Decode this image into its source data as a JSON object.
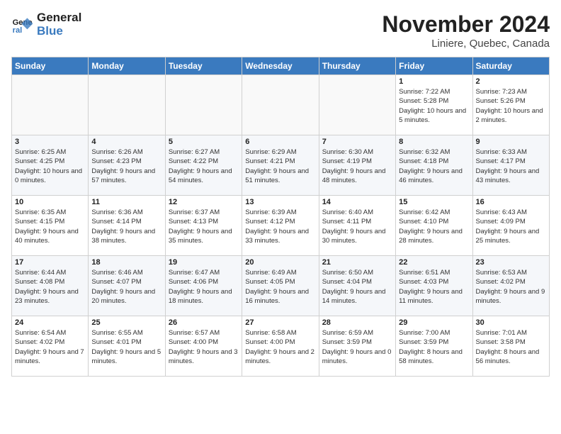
{
  "header": {
    "logo_line1": "General",
    "logo_line2": "Blue",
    "month_title": "November 2024",
    "location": "Liniere, Quebec, Canada"
  },
  "weekdays": [
    "Sunday",
    "Monday",
    "Tuesday",
    "Wednesday",
    "Thursday",
    "Friday",
    "Saturday"
  ],
  "weeks": [
    [
      {
        "day": "",
        "info": ""
      },
      {
        "day": "",
        "info": ""
      },
      {
        "day": "",
        "info": ""
      },
      {
        "day": "",
        "info": ""
      },
      {
        "day": "",
        "info": ""
      },
      {
        "day": "1",
        "info": "Sunrise: 7:22 AM\nSunset: 5:28 PM\nDaylight: 10 hours and 5 minutes."
      },
      {
        "day": "2",
        "info": "Sunrise: 7:23 AM\nSunset: 5:26 PM\nDaylight: 10 hours and 2 minutes."
      }
    ],
    [
      {
        "day": "3",
        "info": "Sunrise: 6:25 AM\nSunset: 4:25 PM\nDaylight: 10 hours and 0 minutes."
      },
      {
        "day": "4",
        "info": "Sunrise: 6:26 AM\nSunset: 4:23 PM\nDaylight: 9 hours and 57 minutes."
      },
      {
        "day": "5",
        "info": "Sunrise: 6:27 AM\nSunset: 4:22 PM\nDaylight: 9 hours and 54 minutes."
      },
      {
        "day": "6",
        "info": "Sunrise: 6:29 AM\nSunset: 4:21 PM\nDaylight: 9 hours and 51 minutes."
      },
      {
        "day": "7",
        "info": "Sunrise: 6:30 AM\nSunset: 4:19 PM\nDaylight: 9 hours and 48 minutes."
      },
      {
        "day": "8",
        "info": "Sunrise: 6:32 AM\nSunset: 4:18 PM\nDaylight: 9 hours and 46 minutes."
      },
      {
        "day": "9",
        "info": "Sunrise: 6:33 AM\nSunset: 4:17 PM\nDaylight: 9 hours and 43 minutes."
      }
    ],
    [
      {
        "day": "10",
        "info": "Sunrise: 6:35 AM\nSunset: 4:15 PM\nDaylight: 9 hours and 40 minutes."
      },
      {
        "day": "11",
        "info": "Sunrise: 6:36 AM\nSunset: 4:14 PM\nDaylight: 9 hours and 38 minutes."
      },
      {
        "day": "12",
        "info": "Sunrise: 6:37 AM\nSunset: 4:13 PM\nDaylight: 9 hours and 35 minutes."
      },
      {
        "day": "13",
        "info": "Sunrise: 6:39 AM\nSunset: 4:12 PM\nDaylight: 9 hours and 33 minutes."
      },
      {
        "day": "14",
        "info": "Sunrise: 6:40 AM\nSunset: 4:11 PM\nDaylight: 9 hours and 30 minutes."
      },
      {
        "day": "15",
        "info": "Sunrise: 6:42 AM\nSunset: 4:10 PM\nDaylight: 9 hours and 28 minutes."
      },
      {
        "day": "16",
        "info": "Sunrise: 6:43 AM\nSunset: 4:09 PM\nDaylight: 9 hours and 25 minutes."
      }
    ],
    [
      {
        "day": "17",
        "info": "Sunrise: 6:44 AM\nSunset: 4:08 PM\nDaylight: 9 hours and 23 minutes."
      },
      {
        "day": "18",
        "info": "Sunrise: 6:46 AM\nSunset: 4:07 PM\nDaylight: 9 hours and 20 minutes."
      },
      {
        "day": "19",
        "info": "Sunrise: 6:47 AM\nSunset: 4:06 PM\nDaylight: 9 hours and 18 minutes."
      },
      {
        "day": "20",
        "info": "Sunrise: 6:49 AM\nSunset: 4:05 PM\nDaylight: 9 hours and 16 minutes."
      },
      {
        "day": "21",
        "info": "Sunrise: 6:50 AM\nSunset: 4:04 PM\nDaylight: 9 hours and 14 minutes."
      },
      {
        "day": "22",
        "info": "Sunrise: 6:51 AM\nSunset: 4:03 PM\nDaylight: 9 hours and 11 minutes."
      },
      {
        "day": "23",
        "info": "Sunrise: 6:53 AM\nSunset: 4:02 PM\nDaylight: 9 hours and 9 minutes."
      }
    ],
    [
      {
        "day": "24",
        "info": "Sunrise: 6:54 AM\nSunset: 4:02 PM\nDaylight: 9 hours and 7 minutes."
      },
      {
        "day": "25",
        "info": "Sunrise: 6:55 AM\nSunset: 4:01 PM\nDaylight: 9 hours and 5 minutes."
      },
      {
        "day": "26",
        "info": "Sunrise: 6:57 AM\nSunset: 4:00 PM\nDaylight: 9 hours and 3 minutes."
      },
      {
        "day": "27",
        "info": "Sunrise: 6:58 AM\nSunset: 4:00 PM\nDaylight: 9 hours and 2 minutes."
      },
      {
        "day": "28",
        "info": "Sunrise: 6:59 AM\nSunset: 3:59 PM\nDaylight: 9 hours and 0 minutes."
      },
      {
        "day": "29",
        "info": "Sunrise: 7:00 AM\nSunset: 3:59 PM\nDaylight: 8 hours and 58 minutes."
      },
      {
        "day": "30",
        "info": "Sunrise: 7:01 AM\nSunset: 3:58 PM\nDaylight: 8 hours and 56 minutes."
      }
    ]
  ]
}
